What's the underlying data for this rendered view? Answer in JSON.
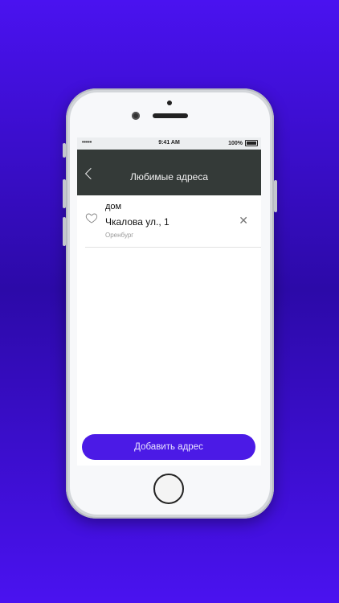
{
  "status_bar": {
    "signal": "•••••",
    "time": "9:41 AM",
    "battery": "100%"
  },
  "header": {
    "title": "Любимые адреса",
    "back_icon": "chevron-left-icon"
  },
  "favorites": [
    {
      "name": "дом",
      "street": "Чкалова ул., 1",
      "city": "Оренбург",
      "icon": "heart-outline-icon",
      "remove_icon": "close-icon"
    }
  ],
  "actions": {
    "add_address_label": "Добавить адрес"
  },
  "colors": {
    "background": "#4a12f0",
    "navbar": "#343a38",
    "accent": "#4b1ae6"
  }
}
